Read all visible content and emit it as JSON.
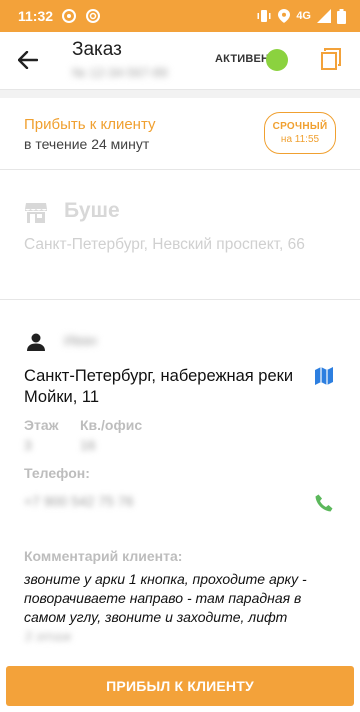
{
  "status_bar": {
    "time": "11:32",
    "network": "4G"
  },
  "header": {
    "title": "Заказ",
    "subtitle_obscured": "№ 12-34-567-89",
    "status_label": "АКТИВЕН",
    "status_color": "#8bd23f",
    "back_icon": "arrow-left-icon",
    "copy_icon": "copy-icon"
  },
  "arrive": {
    "title": "Прибыть к клиенту",
    "subtitle": "в течение 24 минут",
    "urgent_title": "СРОЧНЫЙ",
    "urgent_time": "на 11:55"
  },
  "pickup": {
    "icon": "store-icon",
    "name": "Буше",
    "address": "Санкт-Петербург, Невский проспект, 66"
  },
  "client": {
    "icon": "person-icon",
    "name_obscured": "Иван",
    "address": "Санкт-Петербург, набережная реки Мойки, 11",
    "map_icon": "map-icon",
    "floor_label": "Этаж",
    "floor_obscured": "3",
    "apt_label": "Кв./офис",
    "apt_obscured": "16",
    "phone_label": "Телефон:",
    "phone_obscured": "+7 900 542 75 76",
    "phone_icon": "phone-icon",
    "comment_label": "Комментарий клиента:",
    "comment": "звоните у арки 1 кнопка, проходите арку - поворачиваете направо - там парадная в самом углу, звоните и заходите, лифт",
    "comment_obscured": "3 этаж"
  },
  "action": {
    "arrived_label": "ПРИБЫЛ К КЛИЕНТУ"
  },
  "colors": {
    "accent": "#f3a23a",
    "active": "#8bd23f",
    "map": "#2d7fe0",
    "phone": "#5cb85c"
  }
}
